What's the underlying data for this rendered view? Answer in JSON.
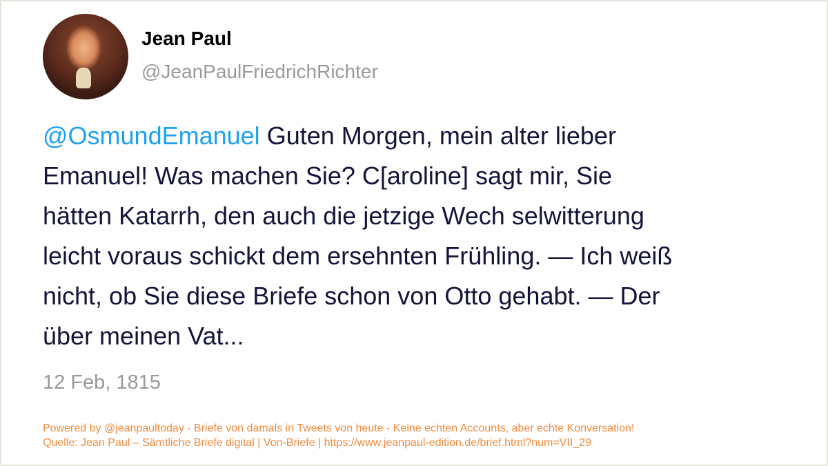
{
  "author": {
    "name": "Jean Paul",
    "handle": "@JeanPaulFriedrichRichter"
  },
  "tweet": {
    "mention": "@OsmundEmanuel",
    "lines": [
      " Guten Morgen, mein alter lieber",
      "Emanuel! Was machen Sie? C[aroline] sagt mir, Sie",
      "hätten Katarrh, den auch die jetzige Wech selwitterung",
      "leicht voraus schickt dem ersehnten Frühling. — Ich weiß",
      "nicht, ob Sie diese Briefe schon von Otto gehabt. — Der",
      "über meinen Vat..."
    ],
    "date": "12 Feb, 1815"
  },
  "footer": {
    "line1": "Powered by @jeanpaultoday - Briefe von damals in Tweets von heute - Keine echten Accounts, aber echte Konversation!",
    "line2": "Quelle: Jean Paul – Sämtliche Briefe digital | Von-Briefe | https://www.jeanpaul-edition.de/brief.html?num=VII_29"
  },
  "colors": {
    "mention": "#1da1f2",
    "footer": "#f28a3c",
    "text": "#14143a"
  }
}
